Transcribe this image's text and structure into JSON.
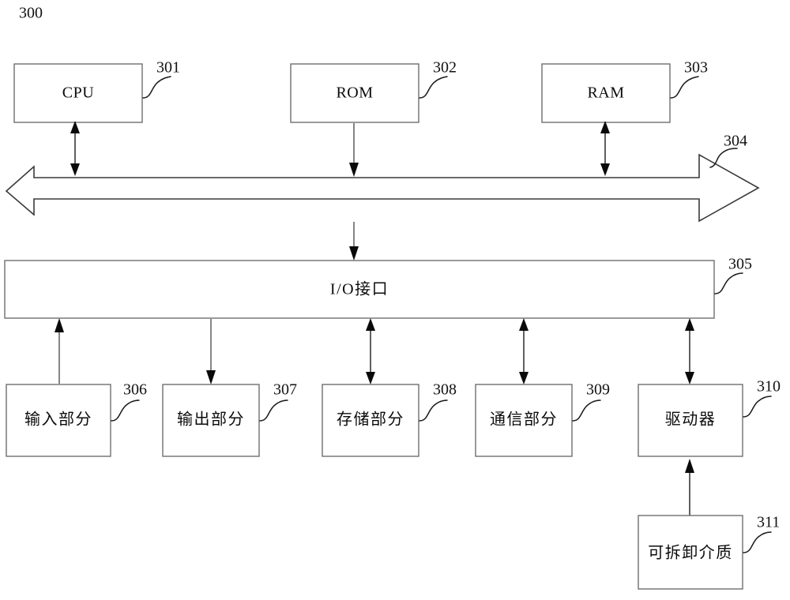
{
  "figure": {
    "figure_number": "300",
    "title_text": ""
  },
  "nodes": [
    {
      "id": "cpu",
      "label": "CPU",
      "ref": "301",
      "script": "latin"
    },
    {
      "id": "rom",
      "label": "ROM",
      "ref": "302",
      "script": "latin"
    },
    {
      "id": "ram",
      "label": "RAM",
      "ref": "303",
      "script": "latin"
    },
    {
      "id": "bus",
      "label": "",
      "ref": "304",
      "script": "none"
    },
    {
      "id": "io",
      "label": "I/O接口",
      "ref": "305",
      "script": "cjk"
    },
    {
      "id": "input",
      "label": "输入部分",
      "ref": "306",
      "script": "cjk"
    },
    {
      "id": "output",
      "label": "输出部分",
      "ref": "307",
      "script": "cjk"
    },
    {
      "id": "storage",
      "label": "存储部分",
      "ref": "308",
      "script": "cjk"
    },
    {
      "id": "comm",
      "label": "通信部分",
      "ref": "309",
      "script": "cjk"
    },
    {
      "id": "driver",
      "label": "驱动器",
      "ref": "310",
      "script": "cjk"
    },
    {
      "id": "media",
      "label": "可拆卸介质",
      "ref": "311",
      "script": "cjk"
    }
  ],
  "connections": [
    {
      "from": "cpu",
      "to": "bus",
      "direction": "bidirectional"
    },
    {
      "from": "rom",
      "to": "bus",
      "direction": "down"
    },
    {
      "from": "ram",
      "to": "bus",
      "direction": "bidirectional"
    },
    {
      "from": "bus",
      "to": "io",
      "direction": "down"
    },
    {
      "from": "input",
      "to": "io",
      "direction": "up"
    },
    {
      "from": "io",
      "to": "output",
      "direction": "down"
    },
    {
      "from": "io",
      "to": "storage",
      "direction": "bidirectional"
    },
    {
      "from": "io",
      "to": "comm",
      "direction": "bidirectional"
    },
    {
      "from": "io",
      "to": "driver",
      "direction": "bidirectional"
    },
    {
      "from": "media",
      "to": "driver",
      "direction": "up"
    }
  ],
  "colors": {
    "background": "#ffffff",
    "box_stroke": "#6e6e6e",
    "connector": "#5c5c5c",
    "text": "#0b0b0b"
  }
}
